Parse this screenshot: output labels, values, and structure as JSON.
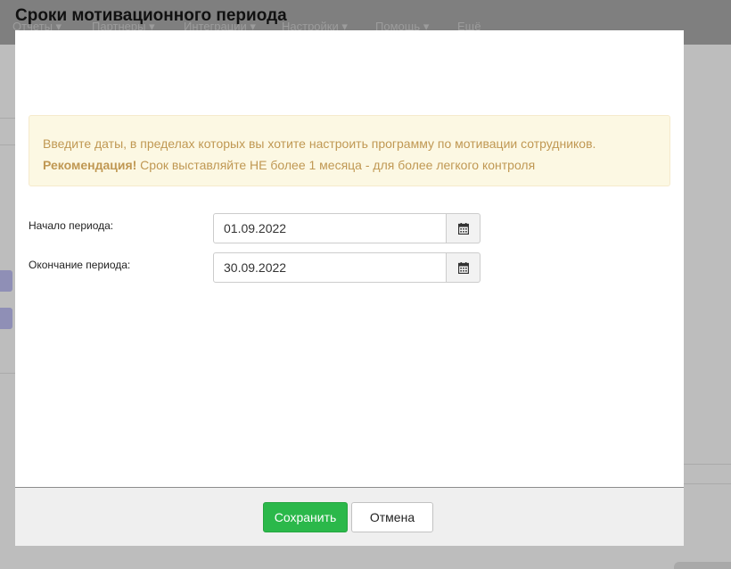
{
  "background": {
    "menu": [
      {
        "label": "Отчеты ▾"
      },
      {
        "label": "Партнеры ▾"
      },
      {
        "label": "Интеграции ▾"
      },
      {
        "label": "Настройки ▾"
      },
      {
        "label": "Помощь ▾"
      },
      {
        "label": "Ещё"
      }
    ]
  },
  "dialog": {
    "title": "Сроки мотивационного периода",
    "alert": {
      "line1": "Введите даты, в пределах которых вы хотите настроить программу по мотивации сотрудников.",
      "recommendation_label": "Рекомендация!",
      "recommendation_text": " Срок выставляйте НЕ более 1 месяца - для более легкого контроля"
    },
    "start": {
      "label": "Начало периода:",
      "value": "01.09.2022",
      "icon": "calendar-icon"
    },
    "end": {
      "label": "Окончание периода:",
      "value": "30.09.2022",
      "icon": "calendar-icon"
    },
    "buttons": {
      "save": "Сохранить",
      "cancel": "Отмена"
    }
  },
  "colors": {
    "save_button": "#2bb84a",
    "alert_bg": "#fcf8e3",
    "alert_text": "#c09853"
  }
}
